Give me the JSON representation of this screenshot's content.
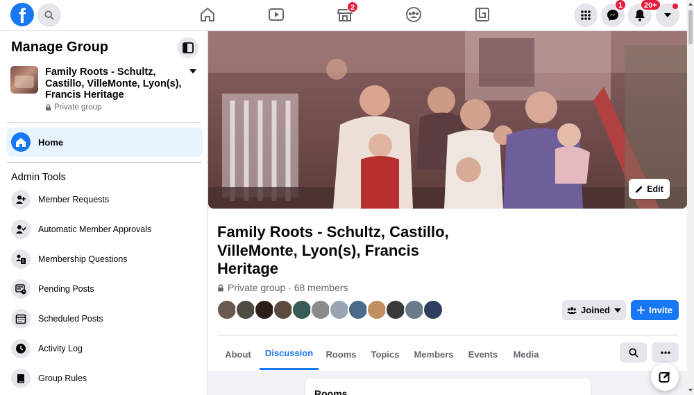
{
  "topbar": {
    "logo_letter": "f",
    "marketplace_badge": "2",
    "messenger_badge": "1",
    "notifications_badge": "20+"
  },
  "sidebar": {
    "title": "Manage Group",
    "group_name": "Family Roots - Schultz, Castillo, VilleMonte, Lyon(s), Francis Heritage",
    "privacy": "Private group",
    "home_label": "Home",
    "admin_tools_title": "Admin Tools",
    "admin_items": [
      {
        "label": "Member Requests",
        "icon": "member-requests-icon"
      },
      {
        "label": "Automatic Member Approvals",
        "icon": "member-approvals-icon"
      },
      {
        "label": "Membership Questions",
        "icon": "membership-questions-icon"
      },
      {
        "label": "Pending Posts",
        "icon": "pending-posts-icon"
      },
      {
        "label": "Scheduled Posts",
        "icon": "scheduled-posts-icon"
      },
      {
        "label": "Activity Log",
        "icon": "clock-icon"
      },
      {
        "label": "Group Rules",
        "icon": "book-icon"
      }
    ]
  },
  "main": {
    "edit_label": "Edit",
    "group_title": "Family Roots - Schultz, Castillo, VilleMonte, Lyon(s), Francis Heritage",
    "meta": "Private group · 68 members",
    "joined_label": "Joined",
    "invite_label": "Invite",
    "tabs": [
      "About",
      "Discussion",
      "Rooms",
      "Topics",
      "Members",
      "Events",
      "Media"
    ],
    "active_tab": "Discussion",
    "rooms_title": "Rooms"
  },
  "colors": {
    "brand": "#1877f2",
    "badge": "#e41e3f",
    "active_bg": "#e7f3ff"
  }
}
